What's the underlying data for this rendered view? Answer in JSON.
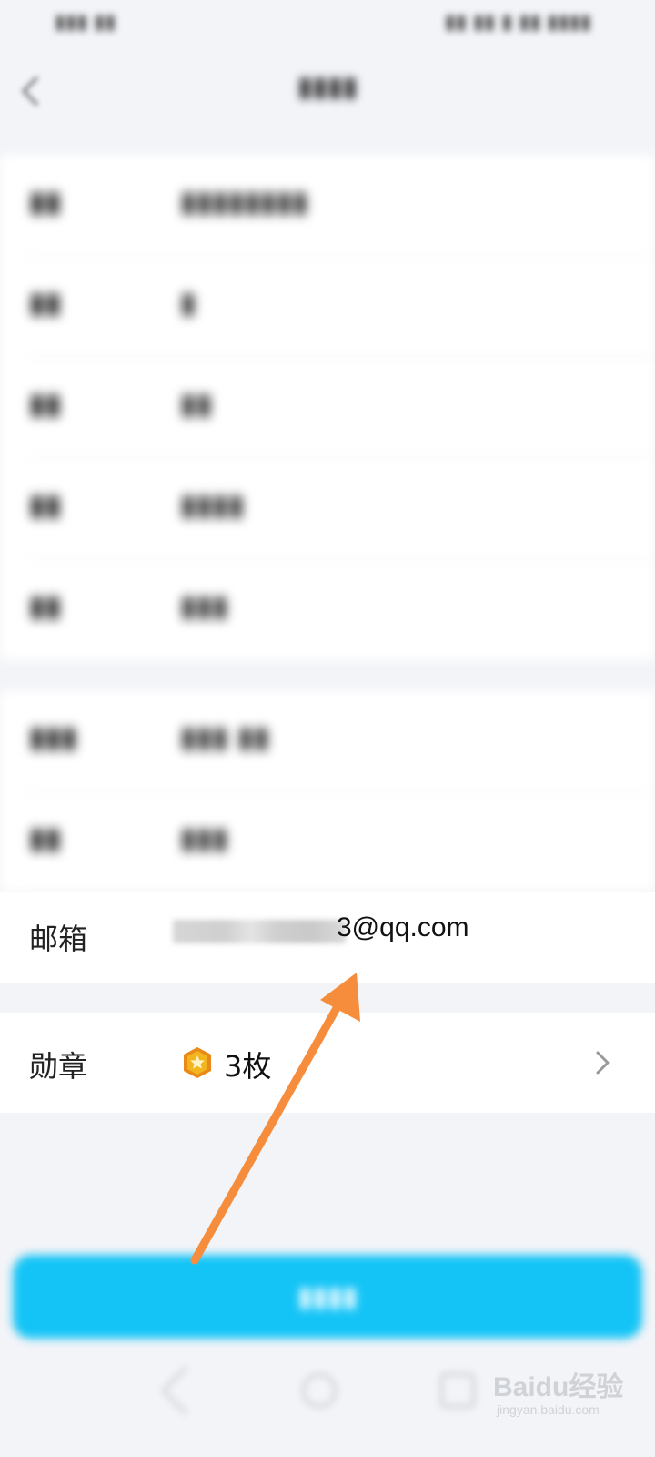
{
  "profile": {
    "email": {
      "label": "邮箱",
      "value_suffix": "3@qq.com"
    },
    "badge": {
      "label": "勋章",
      "count": "3枚"
    }
  },
  "colors": {
    "accent_button": "#14c4f6",
    "annotation_arrow": "#f58d3c",
    "badge_gold": "#f2b51e",
    "badge_orange": "#e98a18"
  },
  "icons": {
    "back": "back-icon",
    "badge": "medal-icon",
    "chevron": "chevron-right-icon"
  },
  "watermark": {
    "logo": "Baidu经验",
    "url": "jingyan.baidu.com"
  }
}
